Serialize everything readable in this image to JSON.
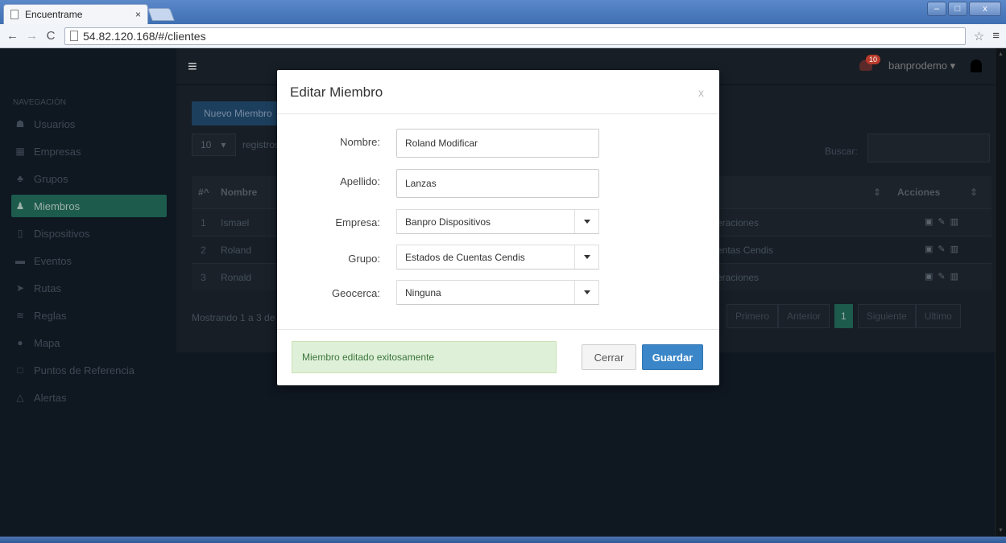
{
  "browser": {
    "tab_title": "Encuentrame",
    "tab_close": "×",
    "url": "54.82.120.168/#/clientes",
    "window_buttons": [
      "–",
      "□",
      "x"
    ]
  },
  "sidebar": {
    "heading": "NAVEGACIÓN",
    "items": [
      {
        "label": "Usuarios",
        "icon": "users-icon"
      },
      {
        "label": "Empresas",
        "icon": "building-icon"
      },
      {
        "label": "Grupos",
        "icon": "sitemap-icon"
      },
      {
        "label": "Miembros",
        "icon": "user-icon",
        "active": true
      },
      {
        "label": "Dispositivos",
        "icon": "mobile-icon"
      },
      {
        "label": "Eventos",
        "icon": "eventos-icon"
      },
      {
        "label": "Rutas",
        "icon": "location-arrow-icon"
      },
      {
        "label": "Reglas",
        "icon": "reglas-icon"
      },
      {
        "label": "Mapa",
        "icon": "map-marker-icon"
      },
      {
        "label": "Puntos de Referencia",
        "icon": "square-icon"
      },
      {
        "label": "Alertas",
        "icon": "bell-icon"
      }
    ]
  },
  "topbar": {
    "notifications_count": "10",
    "username": "banprodemo ▾"
  },
  "main": {
    "new_button": "Nuevo Miembro",
    "length_value": "10",
    "length_label": "registros",
    "search_label": "Buscar:",
    "table": {
      "headers": [
        "#^",
        "Nombre",
        "Acciones"
      ],
      "rows": [
        {
          "n": "1",
          "name": "Ismael",
          "group": "eraciones"
        },
        {
          "n": "2",
          "name": "Roland",
          "group": "entas Cendis"
        },
        {
          "n": "3",
          "name": "Ronald",
          "group": "eraciones"
        }
      ]
    },
    "info": "Mostrando 1 a 3 de",
    "pagination": [
      "Primero",
      "Anterior",
      "1",
      "Siguiente",
      "Ultimo"
    ]
  },
  "modal": {
    "title": "Editar Miembro",
    "close": "x",
    "fields": {
      "nombre_label": "Nombre:",
      "nombre_value": "Roland Modificar",
      "apellido_label": "Apellido:",
      "apellido_value": "Lanzas",
      "empresa_label": "Empresa:",
      "empresa_value": "Banpro Dispositivos",
      "grupo_label": "Grupo:",
      "grupo_value": "Estados de Cuentas Cendis",
      "geocerca_label": "Geocerca:",
      "geocerca_value": "Ninguna"
    },
    "alert": "Miembro editado exitosamente",
    "cancel": "Cerrar",
    "save": "Guardar"
  },
  "colors": {
    "accent": "#3a86c8",
    "active_nav": "#1d5b4c",
    "success_bg": "#dff0d8"
  }
}
